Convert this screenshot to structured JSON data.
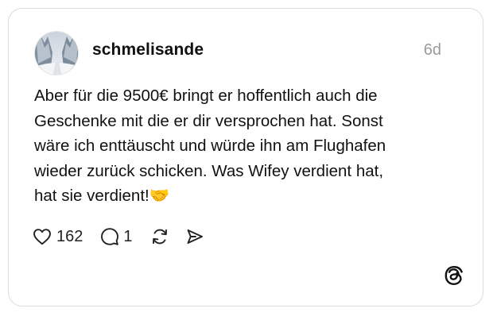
{
  "post": {
    "username": "schmelisande",
    "time": "6d",
    "text": "Aber für die 9500€ bringt er hoffentlich auch die\nGeschenke mit die er dir versprochen hat. Sonst\nwäre ich enttäuscht und würde ihn am Flughafen\nwieder zurück schicken. Was Wifey verdient hat,\nhat sie verdient!🤝",
    "likes": "162",
    "replies": "1"
  },
  "icons": {
    "like": "heart-icon",
    "reply": "speech-bubble-icon",
    "repost": "repost-arrows-icon",
    "share": "send-icon",
    "brand": "threads-logo-icon"
  },
  "colors": {
    "text": "#111111",
    "muted": "#9a9a9a",
    "border": "#dcdcdc"
  }
}
